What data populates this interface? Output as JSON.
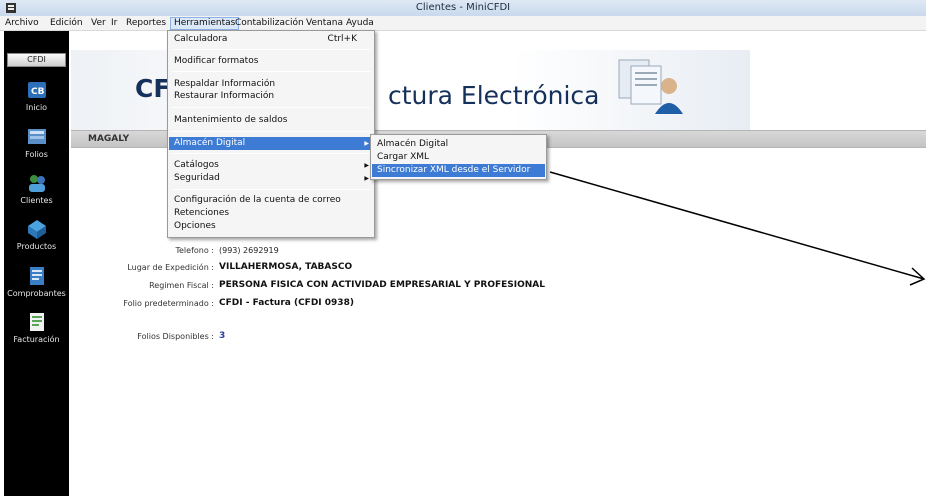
{
  "window": {
    "title": "Clientes - MiniCFDI"
  },
  "menubar": {
    "items": [
      "Archivo",
      "Edición",
      "Ver",
      "Ir",
      "Reportes",
      "Herramientas",
      "Contabilización",
      "Ventana",
      "Ayuda"
    ]
  },
  "leftnav": {
    "header": "CFDI",
    "items": [
      {
        "label": "Inicio",
        "icon": "home-icon"
      },
      {
        "label": "Folios",
        "icon": "folios-icon"
      },
      {
        "label": "Clientes",
        "icon": "clients-icon"
      },
      {
        "label": "Productos",
        "icon": "products-icon"
      },
      {
        "label": "Comprobantes",
        "icon": "receipts-icon"
      },
      {
        "label": "Facturación",
        "icon": "invoice-icon"
      }
    ]
  },
  "banner": {
    "text_left": "CF",
    "text_right": "ctura Electrónica"
  },
  "user": {
    "name": "MAGALY"
  },
  "info": {
    "telefono_label": "Telefono :",
    "telefono_value": "(993) 2692919",
    "lugar_label": "Lugar de Expedición :",
    "lugar_value": "VILLAHERMOSA, TABASCO",
    "regimen_label": "Regimen Fiscal :",
    "regimen_value": "PERSONA FISICA CON ACTIVIDAD EMPRESARIAL Y PROFESIONAL",
    "folio_label": "Folio predeterminado :",
    "folio_value": "CFDI - Factura (CFDI 0938)",
    "disponibles_label": "Folios Disponibles :",
    "disponibles_value": "3"
  },
  "herramientas_menu": {
    "calculadora": "Calculadora",
    "calculadora_shortcut": "Ctrl+K",
    "modificar": "Modificar formatos",
    "respaldar": "Respaldar Información",
    "restaurar": "Restaurar Información",
    "mantenimiento": "Mantenimiento de saldos",
    "almacen": "Almacén Digital",
    "catalogos": "Catálogos",
    "seguridad": "Seguridad",
    "config_correo": "Configuración de la cuenta de correo",
    "retenciones": "Retenciones",
    "opciones": "Opciones"
  },
  "almacen_submenu": {
    "almacen": "Almacén Digital",
    "cargar": "Cargar XML",
    "sincronizar": "Sincronizar XML desde el Servidor"
  },
  "colors": {
    "highlight": "#3e7bd4",
    "banner_text": "#15305a",
    "nav_bg": "#000000"
  }
}
